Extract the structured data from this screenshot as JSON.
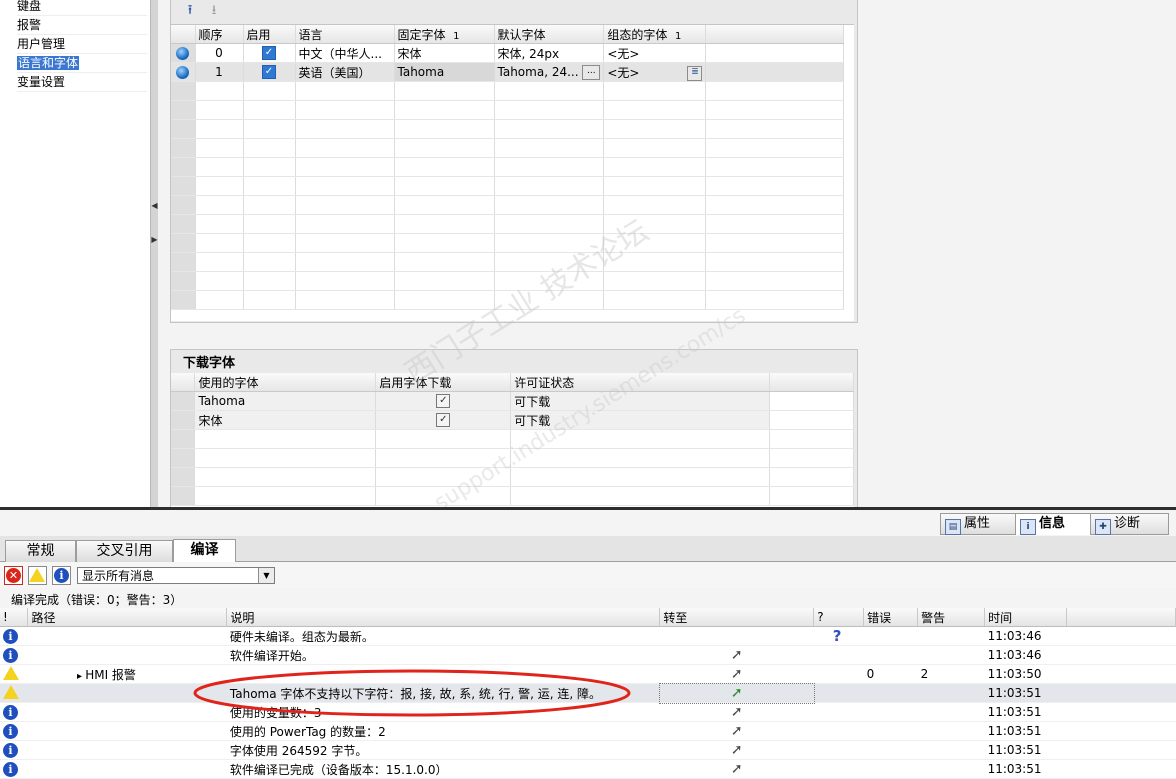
{
  "left_nav": {
    "items": [
      {
        "label": "键盘"
      },
      {
        "label": "报警"
      },
      {
        "label": "用户管理"
      },
      {
        "label": "语言和字体",
        "selected": true
      },
      {
        "label": "变量设置"
      }
    ]
  },
  "lang_table": {
    "headers": [
      "顺序",
      "启用",
      "语言",
      "固定字体",
      "默认字体",
      "组态的字体"
    ],
    "sort_index_fixed": "1",
    "sort_index_config": "1",
    "rows": [
      {
        "order": "0",
        "enabled": true,
        "language": "中文（中华人...",
        "fixed_font": "宋体",
        "default_font": "宋体, 24px",
        "config_font": "<无>"
      },
      {
        "order": "1",
        "enabled": true,
        "language": "英语（美国）",
        "fixed_font": "Tahoma",
        "default_font": "Tahoma, 24...",
        "config_font": "<无>"
      }
    ],
    "ellipsis_label": "..."
  },
  "download_fonts": {
    "title": "下载字体",
    "headers": [
      "使用的字体",
      "启用字体下载",
      "许可证状态"
    ],
    "rows": [
      {
        "font": "Tahoma",
        "enabled": true,
        "status": "可下载"
      },
      {
        "font": "宋体",
        "enabled": true,
        "status": "可下载"
      }
    ]
  },
  "inspector_tabs": [
    {
      "label": "属性",
      "icon": "properties-icon"
    },
    {
      "label": "信息",
      "icon": "info-tab-icon",
      "active": true
    },
    {
      "label": "诊断",
      "icon": "diagnostics-icon"
    }
  ],
  "info_tabs": [
    {
      "label": "常规"
    },
    {
      "label": "交叉引用"
    },
    {
      "label": "编译",
      "active": true
    }
  ],
  "filter": {
    "selected": "显示所有消息"
  },
  "summary": "编译完成（错误：0；警告：3）",
  "messages": {
    "headers": {
      "bang": "!",
      "path": "路径",
      "desc": "说明",
      "goto": "转至",
      "q": "?",
      "errors": "错误",
      "warnings": "警告",
      "time": "时间"
    },
    "rows": [
      {
        "type": "info",
        "path": "",
        "desc": "硬件未编译。组态为最新。",
        "goto": false,
        "q": true,
        "errors": "",
        "warnings": "",
        "time": "11:03:46"
      },
      {
        "type": "info",
        "path": "",
        "desc": "软件编译开始。",
        "goto": true,
        "q": false,
        "errors": "",
        "warnings": "",
        "time": "11:03:46"
      },
      {
        "type": "warn",
        "path": "HMI 报警",
        "desc": "",
        "goto": true,
        "q": false,
        "errors": "0",
        "warnings": "2",
        "time": "11:03:50"
      },
      {
        "type": "warn",
        "path": "",
        "desc": "Tahoma 字体不支持以下字符：报, 接, 故, 系, 统, 行, 警, 运, 连, 障。",
        "goto": true,
        "q": false,
        "errors": "",
        "warnings": "",
        "time": "11:03:51",
        "highlight": true
      },
      {
        "type": "info",
        "path": "",
        "desc": "使用的变量数：3",
        "goto": true,
        "q": false,
        "errors": "",
        "warnings": "",
        "time": "11:03:51"
      },
      {
        "type": "info",
        "path": "",
        "desc": "使用的 PowerTag 的数量：2",
        "goto": true,
        "q": false,
        "errors": "",
        "warnings": "",
        "time": "11:03:51"
      },
      {
        "type": "info",
        "path": "",
        "desc": "字体使用 264592 字节。",
        "goto": true,
        "q": false,
        "errors": "",
        "warnings": "",
        "time": "11:03:51"
      },
      {
        "type": "info",
        "path": "",
        "desc": "软件编译已完成（设备版本：15.1.0.0）",
        "goto": true,
        "q": false,
        "errors": "",
        "warnings": "",
        "time": "11:03:51"
      }
    ]
  },
  "watermark": {
    "line1": "西门子工业 技术论坛",
    "line2": "support.industry.siemens.com/cs"
  },
  "colors": {
    "annotation_ellipse": "#e0231b",
    "selection": "#3a77d0"
  }
}
